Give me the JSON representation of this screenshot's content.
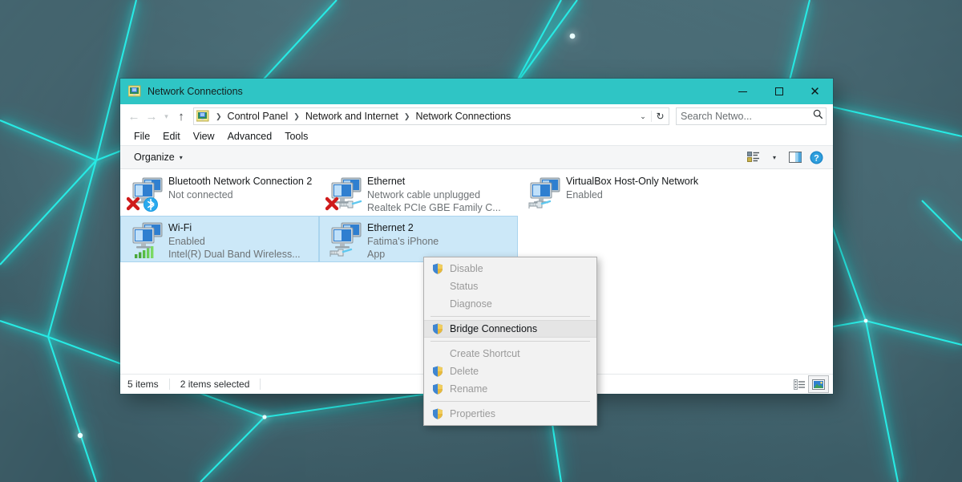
{
  "desktop": {
    "wallpaper_base_color": "#43616b",
    "wallpaper_glow_color": "#18e5e0",
    "wallpaper_name": "abstract-cyan-polygon-wallpaper"
  },
  "window": {
    "title": "Network Connections",
    "title_icon": "network-connections-icon",
    "titlebar_color": "#2fc5c5",
    "caption": {
      "minimize_label": "Minimize",
      "maximize_label": "Maximize",
      "close_label": "Close"
    }
  },
  "address_bar": {
    "back_label": "Back",
    "forward_label": "Forward",
    "recent_label": "Recent locations",
    "up_label": "Up one level",
    "crumb_icon": "network-connections-icon",
    "breadcrumbs": [
      "Control Panel",
      "Network and Internet",
      "Network Connections"
    ],
    "separator": "❯",
    "dropdown_chevron": "⌄",
    "refresh_glyph": "↻",
    "search": {
      "placeholder": "Search Netwo...",
      "value": "",
      "icon": "search-icon"
    }
  },
  "menubar": {
    "items": [
      "File",
      "Edit",
      "View",
      "Advanced",
      "Tools"
    ]
  },
  "toolbar": {
    "organize_label": "Organize",
    "organize_chevron": "▾",
    "view_options_icon": "change-view-icon",
    "view_options_chevron": "▾",
    "preview_pane_icon": "preview-pane-icon",
    "help_icon": "help-icon"
  },
  "connections": [
    {
      "name": "Bluetooth Network Connection 2",
      "status": "Not connected",
      "device": "",
      "selected": false,
      "badge": "bluetooth-badge-icon",
      "disconnected": true
    },
    {
      "name": "Ethernet",
      "status": "Network cable unplugged",
      "device": "Realtek PCIe GBE Family C...",
      "selected": false,
      "badge": "rj45-cable-badge-icon",
      "disconnected": true
    },
    {
      "name": "VirtualBox Host-Only Network",
      "status": "Enabled",
      "device": "",
      "selected": false,
      "badge": "rj45-cable-badge-icon",
      "disconnected": false
    },
    {
      "name": "Wi-Fi",
      "status": "Enabled",
      "device": "Intel(R) Dual Band Wireless...",
      "selected": true,
      "badge": "wifi-signal-badge-icon",
      "disconnected": false
    },
    {
      "name": "Ethernet 2",
      "status": "Fatima's iPhone",
      "device": "App",
      "selected": true,
      "badge": "rj45-cable-badge-icon",
      "disconnected": false
    }
  ],
  "context_menu": {
    "items": [
      {
        "label": "Disable",
        "icon": "uac-shield-icon",
        "enabled": false,
        "highlighted": false,
        "separator_after": false
      },
      {
        "label": "Status",
        "icon": "",
        "enabled": false,
        "highlighted": false,
        "separator_after": false
      },
      {
        "label": "Diagnose",
        "icon": "",
        "enabled": false,
        "highlighted": false,
        "separator_after": true
      },
      {
        "label": "Bridge Connections",
        "icon": "uac-shield-icon",
        "enabled": true,
        "highlighted": true,
        "separator_after": true
      },
      {
        "label": "Create Shortcut",
        "icon": "",
        "enabled": false,
        "highlighted": false,
        "separator_after": false
      },
      {
        "label": "Delete",
        "icon": "uac-shield-icon",
        "enabled": false,
        "highlighted": false,
        "separator_after": false
      },
      {
        "label": "Rename",
        "icon": "uac-shield-icon",
        "enabled": false,
        "highlighted": false,
        "separator_after": true
      },
      {
        "label": "Properties",
        "icon": "uac-shield-icon",
        "enabled": false,
        "highlighted": false,
        "separator_after": false
      }
    ]
  },
  "status_bar": {
    "item_count": "5 items",
    "selected_count": "2 items selected",
    "details_view_icon": "details-view-icon",
    "large_icons_view_icon": "large-icons-view-icon",
    "active_view": "large-icons"
  }
}
